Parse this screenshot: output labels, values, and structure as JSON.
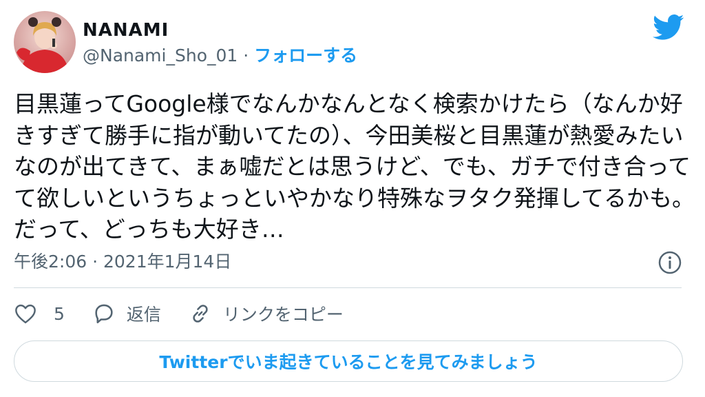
{
  "author": {
    "display_name": "NANAMI",
    "handle": "@Nanami_Sho_01",
    "separator": " · ",
    "follow_label": "フォローする"
  },
  "tweet": {
    "text": "目黒蓮ってGoogle様でなんかなんとなく検索かけたら（なんか好きすぎて勝手に指が動いてたの）、今田美桜と目黒蓮が熱愛みたいなのが出てきて、まぁ嘘だとは思うけど、でも、ガチで付き合ってて欲しいというちょっといやかなり特殊なヲタク発揮してるかも。だって、どっちも大好き…",
    "timestamp": "午後2:06 · 2021年1月14日"
  },
  "actions": {
    "like_count": "5",
    "reply_label": "返信",
    "copy_link_label": "リンクをコピー"
  },
  "cta": {
    "label": "Twitterでいま起きていることを見てみましょう"
  },
  "icons": {
    "logo": "twitter-bird-icon",
    "info": "info-icon",
    "like": "heart-icon",
    "reply": "speech-bubble-icon",
    "copy_link": "link-icon"
  },
  "colors": {
    "accent": "#1d9bf0",
    "secondary_text": "#536471",
    "divider": "#cfd9de"
  }
}
